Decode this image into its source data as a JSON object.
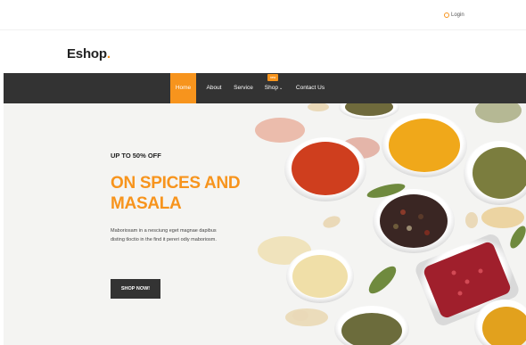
{
  "topbar": {
    "login_label": "Login"
  },
  "brand": {
    "name": "Eshop",
    "dot": "."
  },
  "nav": {
    "items": [
      {
        "label": "Home",
        "active": true
      },
      {
        "label": "About"
      },
      {
        "label": "Service"
      },
      {
        "label": "Shop",
        "badge": "new"
      },
      {
        "label": "Contact Us"
      }
    ]
  },
  "hero": {
    "sale_text": "UP TO 50% OFF",
    "headline_line1": "ON SPICES AND",
    "headline_line2": "MASALA",
    "description": "Maboriosam in a nesciung eget magnae dapibus disting tloctio in the find it pereri odiy maboriosm.",
    "button_label": "SHOP NOW!"
  },
  "colors": {
    "accent": "#f7941d",
    "dark": "#333333",
    "text": "#222222"
  },
  "icons": {
    "login": "user-circle-icon",
    "dropdown": "chevron-down-icon"
  }
}
